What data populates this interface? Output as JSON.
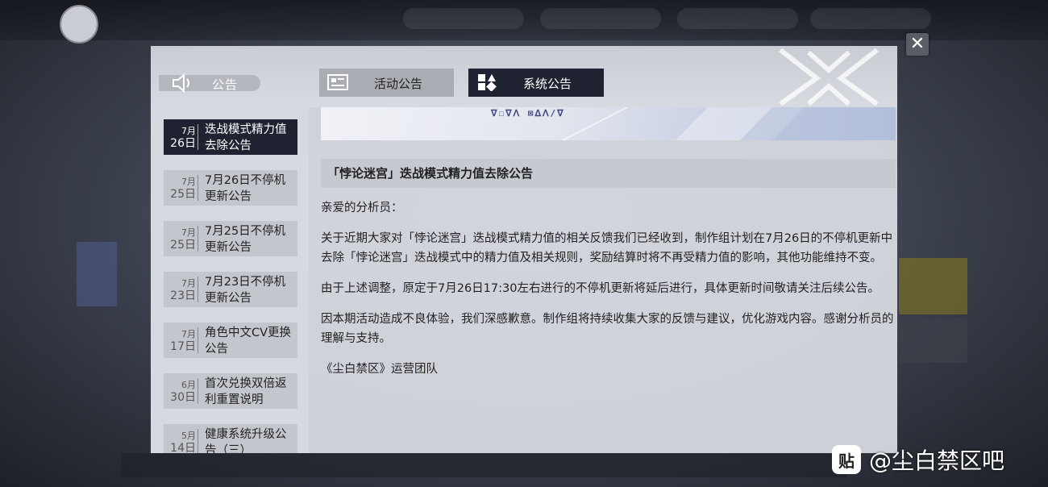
{
  "header": {
    "section_label": "公告",
    "tabs": [
      {
        "label": "活动公告",
        "active": false
      },
      {
        "label": "系统公告",
        "active": true
      }
    ]
  },
  "sidebar": {
    "items": [
      {
        "month": "7月",
        "day": "26日",
        "title": "迭战模式精力值去除公告",
        "active": true
      },
      {
        "month": "7月",
        "day": "25日",
        "title": "7月26日不停机更新公告",
        "active": false
      },
      {
        "month": "7月",
        "day": "25日",
        "title": "7月25日不停机更新公告",
        "active": false
      },
      {
        "month": "7月",
        "day": "23日",
        "title": "7月23日不停机更新公告",
        "active": false
      },
      {
        "month": "7月",
        "day": "17日",
        "title": "角色中文CV更换公告",
        "active": false
      },
      {
        "month": "6月",
        "day": "30日",
        "title": "首次兑换双倍返利重置说明",
        "active": false
      },
      {
        "month": "5月",
        "day": "14日",
        "title": "健康系统升级公告（三）",
        "active": false
      }
    ]
  },
  "article": {
    "banner_logo": "ᐁ☐ᐁᐱ ⊠ᐃᐱ/ᐁ",
    "title": "「悖论迷宫」迭战模式精力值去除公告",
    "greeting": "亲爱的分析员：",
    "paragraphs": [
      "关于近期大家对「悖论迷宫」迭战模式精力值的相关反馈我们已经收到，制作组计划在7月26日的不停机更新中去除「悖论迷宫」迭战模式中的精力值及相关规则，奖励结算时将不再受精力值的影响，其他功能维持不变。",
      "由于上述调整，原定于7月26日17:30左右进行的不停机更新将延后进行，具体更新时间敬请关注后续公告。",
      "因本期活动造成不良体验，我们深感歉意。制作组将持续收集大家的反馈与建议，优化游戏内容。感谢分析员的理解与支持。"
    ],
    "signature": "《尘白禁区》运营团队"
  },
  "close_icon": "close-icon",
  "watermark": {
    "icon_glyph": "贴",
    "text": "@尘白禁区吧"
  },
  "colors": {
    "active_dark": "#1f2231",
    "panel_bg": "#dadde4"
  }
}
